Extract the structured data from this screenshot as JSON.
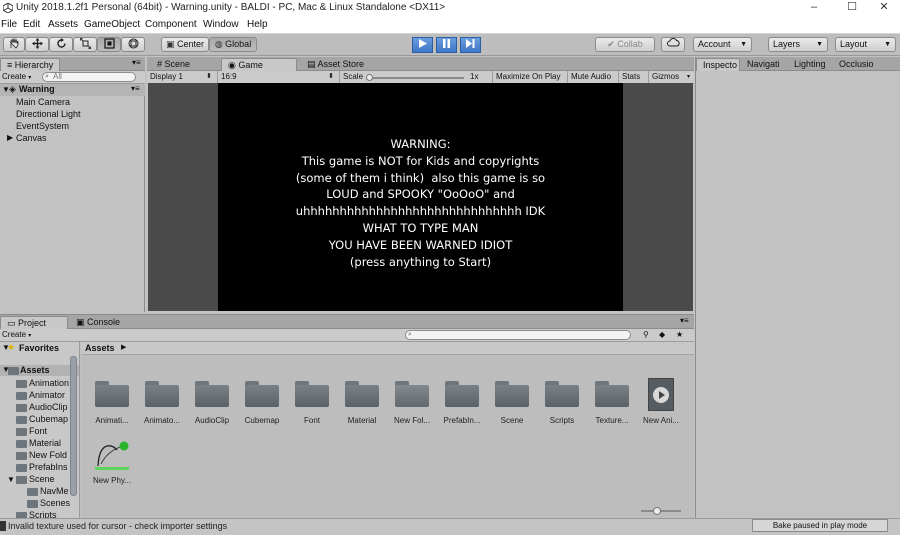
{
  "window": {
    "title": "Unity 2018.1.2f1 Personal (64bit) - Warning.unity - BALDI - PC, Mac & Linux Standalone <DX11>",
    "minimize": "–",
    "maximize": "☐",
    "close": "✕"
  },
  "menu": [
    "File",
    "Edit",
    "Assets",
    "GameObject",
    "Component",
    "Window",
    "Help"
  ],
  "toolbar": {
    "pivot_center": "Center",
    "pivot_global": "Global",
    "collab": "Collab",
    "account": "Account",
    "layers": "Layers",
    "layout": "Layout"
  },
  "hierarchy": {
    "tab": "Hierarchy",
    "create": "Create",
    "search_placeholder": "All",
    "scene": "Warning",
    "items": [
      "Main Camera",
      "Directional Light",
      "EventSystem",
      "Canvas"
    ]
  },
  "center_tabs": [
    "Scene",
    "Game",
    "Asset Store"
  ],
  "game": {
    "display": "Display 1",
    "aspect": "16:9",
    "scale_label": "Scale",
    "scale_value": "1x",
    "maximize": "Maximize On Play",
    "mute": "Mute Audio",
    "stats": "Stats",
    "gizmos": "Gizmos",
    "screen_text": "WARNING:\nThis game is NOT for Kids and copyrights\n(some of them i think)  also this game is so\nLOUD and SPOOKY \"OoOoO\" and\nuhhhhhhhhhhhhhhhhhhhhhhhhhhhhhh IDK\nWHAT TO TYPE MAN\nYOU HAVE BEEN WARNED IDIOT\n(press anything to Start)"
  },
  "inspector_tabs": [
    "Inspecto",
    "Navigati",
    "Lighting",
    "Occlusio"
  ],
  "project": {
    "tabs": [
      "Project",
      "Console"
    ],
    "create": "Create",
    "favorites": "Favorites",
    "assets_header": "Assets",
    "tree": [
      "Assets",
      "Animation",
      "Animator",
      "AudioClip",
      "Cubemap",
      "Font",
      "Material",
      "New Fold",
      "PrefabIns",
      "Scene",
      "NavMe",
      "Scenes",
      "Scripts"
    ],
    "assets": [
      "Animati...",
      "Animato...",
      "AudioClip",
      "Cubemap",
      "Font",
      "Material",
      "New Fol...",
      "PrefabIn...",
      "Scene",
      "Scripts",
      "Texture...",
      "New Ani...",
      "New Phy..."
    ]
  },
  "status": {
    "message": "Invalid texture used for cursor - check importer settings",
    "bake": "Bake paused in play mode"
  },
  "colors": {
    "play_blue": "#3f77c8",
    "editor_gray": "#c2c2c2",
    "game_black": "#000000"
  }
}
